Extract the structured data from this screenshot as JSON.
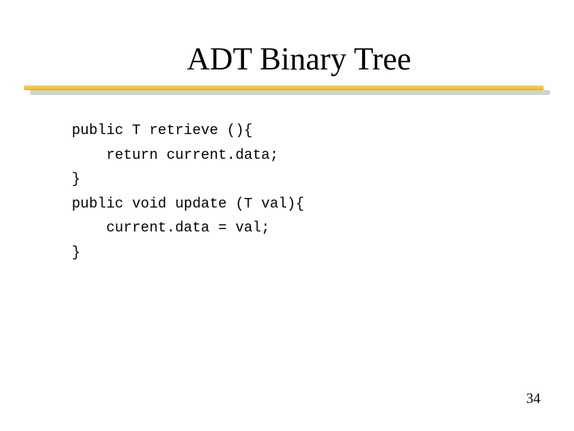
{
  "slide": {
    "title": "ADT Binary Tree",
    "code_lines": [
      "public T retrieve (){",
      "    return current.data;",
      "}",
      "public void update (T val){",
      "    current.data = val;",
      "}"
    ],
    "page_number": "34"
  }
}
